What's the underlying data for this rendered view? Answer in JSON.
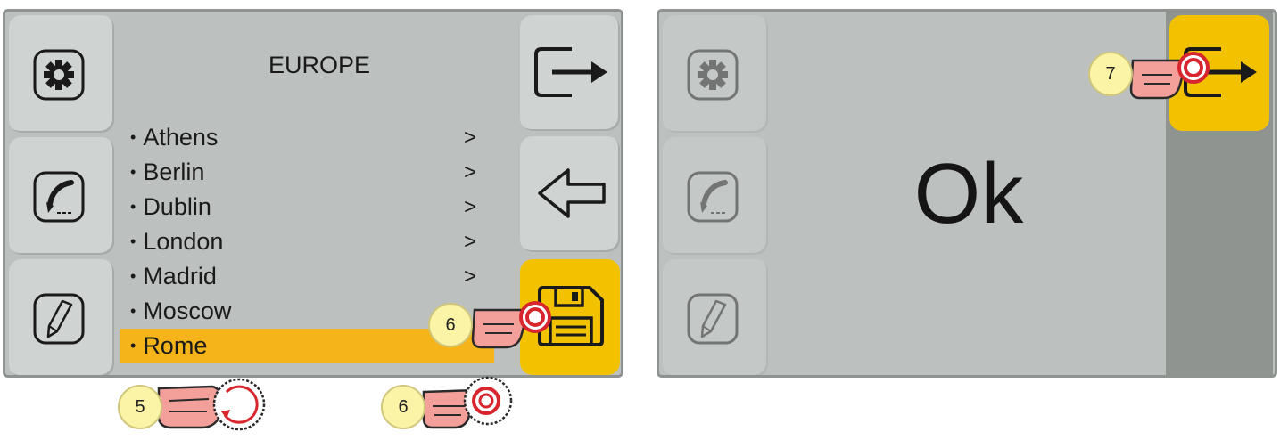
{
  "left_screen": {
    "title": "EUROPE",
    "cities": [
      {
        "name": "Athens",
        "arrow": ">"
      },
      {
        "name": "Berlin",
        "arrow": ">"
      },
      {
        "name": "Dublin",
        "arrow": ">"
      },
      {
        "name": "London",
        "arrow": ">"
      },
      {
        "name": "Madrid",
        "arrow": ">"
      },
      {
        "name": "Moscow",
        "arrow": ""
      },
      {
        "name": "Rome",
        "arrow": ""
      }
    ],
    "bullet": "•",
    "selected_city": "Rome",
    "side_icons": [
      "gear-icon",
      "welding-torch-icon",
      "pencil-icon"
    ],
    "right_icons": [
      "exit-icon",
      "back-arrow-icon",
      "save-floppy-icon"
    ]
  },
  "right_screen": {
    "message": "Ok",
    "right_icons": [
      "exit-icon"
    ]
  },
  "steps": {
    "step5": "5",
    "step6_screen": "6",
    "step6_knob": "6",
    "step7": "7"
  },
  "colors": {
    "selection": "#f5b419",
    "active_button": "#f2c200",
    "screen_bg": "#bcc1bf",
    "badge": "#fbf3a6",
    "touch_ring": "#d8262e"
  }
}
